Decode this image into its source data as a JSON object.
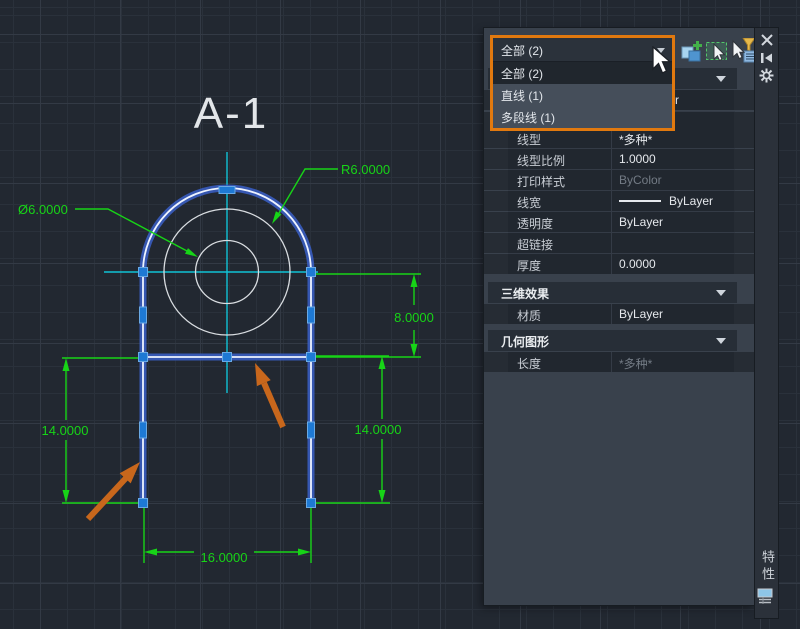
{
  "canvas": {
    "drawing_label": "A-1",
    "dimensions": {
      "radius": "R6.0000",
      "diameter": "Ø6.0000",
      "vertical_8": "8.0000",
      "left_14": "14.0000",
      "right_14": "14.0000",
      "bottom_16": "16.0000"
    }
  },
  "panel": {
    "title": "特性",
    "selection_filter": {
      "value": "全部 (2)",
      "options": [
        "全部 (2)",
        "直线 (1)",
        "多段线 (1)"
      ]
    },
    "hidden_row_fragment": "r",
    "general_rows": [
      {
        "label": "线型",
        "value": "*多种*"
      },
      {
        "label": "线型比例",
        "value": "1.0000"
      },
      {
        "label": "打印样式",
        "value": "ByColor"
      },
      {
        "label": "线宽",
        "value": "ByLayer"
      },
      {
        "label": "透明度",
        "value": "ByLayer"
      },
      {
        "label": "超链接",
        "value": ""
      },
      {
        "label": "厚度",
        "value": "0.0000"
      }
    ],
    "sections": [
      {
        "header": "三维效果",
        "rows": [
          {
            "label": "材质",
            "value": "ByLayer"
          }
        ]
      },
      {
        "header": "几何图形",
        "rows": [
          {
            "label": "长度",
            "value": "*多种*"
          }
        ]
      }
    ]
  },
  "colors": {
    "dimension_green": "#17d417",
    "crosshair_cyan": "#10c3d6",
    "selection_blue": "#3a5fc8",
    "grip_blue": "#1e79d4",
    "callout_orange": "#c8671c",
    "accent_border": "#e1790f"
  }
}
